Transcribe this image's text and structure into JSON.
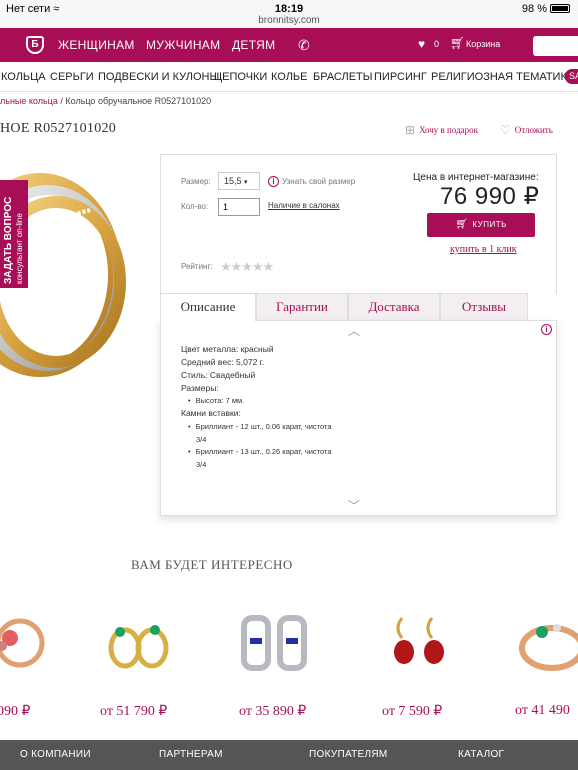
{
  "statusbar": {
    "carrier": "Нет сети",
    "time": "18:19",
    "url": "bronnitsy.com",
    "battery": "98 %"
  },
  "topnav": {
    "items": [
      "ЖЕНЩИНАМ",
      "МУЖЧИНАМ",
      "ДЕТЯМ"
    ],
    "favorites_count": "0",
    "cart_label": "Корзина",
    "accent": "#a80e56"
  },
  "categories": {
    "items": [
      "КОЛЬЦА",
      "СЕРЬГИ",
      "ПОДВЕСКИ И КУЛОНЫ",
      "ЦЕПОЧКИ",
      "КОЛЬЕ",
      "БРАСЛЕТЫ",
      "ПИРСИНГ",
      "РЕЛИГИОЗНАЯ ТЕМАТИКА"
    ],
    "sale": "SA"
  },
  "breadcrumb": {
    "link": "льные кольца",
    "separator": "/",
    "current": "Кольцо обручальное R0527101020"
  },
  "product": {
    "title": "НОЕ R0527101020",
    "gift_link": "Хочу в подарок",
    "later_link": "Отложить",
    "ask_question": "ЗАДАТЬ ВОПРОС",
    "consultant": "консультант on-line",
    "size_label": "Размер:",
    "size_value": "15,5",
    "size_link": "Узнать свой размер",
    "qty_label": "Кол-во:",
    "qty_value": "1",
    "avail_link": "Наличие в салонах",
    "rating_label": "Рейтинг:",
    "price_label": "Цена в интернет-магазине:",
    "price": "76 990 ₽",
    "buy_button": "КУПИТЬ",
    "one_click": "купить в 1 клик"
  },
  "tabs": [
    "Описание",
    "Гарантии",
    "Доставка",
    "Отзывы"
  ],
  "description": {
    "lines": [
      "Цвет металла: красный",
      "Средний вес: 5,072 г.",
      "Стиль: Свадебный",
      "Размеры:"
    ],
    "size_items": [
      "Высота: 7 мм."
    ],
    "stones_label": "Камни вставки:",
    "stones": [
      {
        "line1": "Бриллиант - 12 шт., 0.06 карат, чистота",
        "line2": "3/4"
      },
      {
        "line1": "Бриллиант - 13 шт., 0.26 карат, чистота",
        "line2": "3/4"
      }
    ]
  },
  "recommendations": {
    "title": "ВАМ БУДЕТ ИНТЕРЕСНО",
    "prices": [
      "090 ₽",
      "от 51 790 ₽",
      "от 35 890 ₽",
      "от 7 590 ₽",
      "от 41 490"
    ]
  },
  "footer": {
    "items": [
      "О КОМПАНИИ",
      "ПАРТНЕРАМ",
      "ПОКУПАТЕЛЯМ",
      "КАТАЛОГ"
    ]
  }
}
